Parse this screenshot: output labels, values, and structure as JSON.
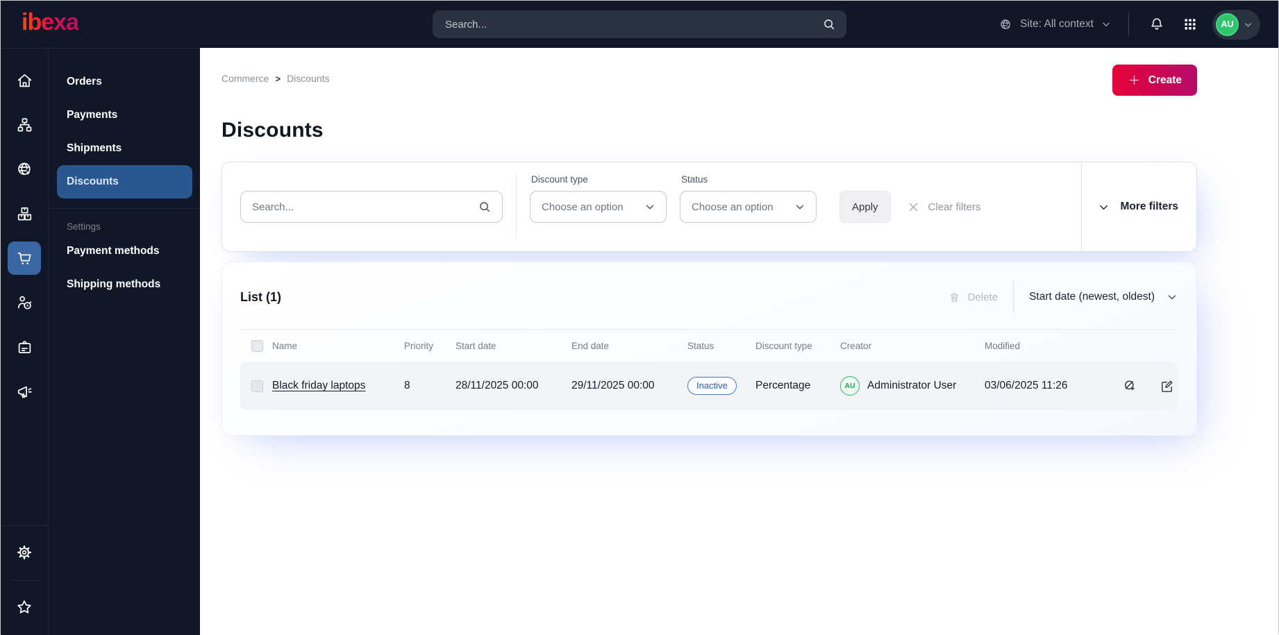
{
  "topbar": {
    "logo_text": "ibexa",
    "search_placeholder": "Search...",
    "site_context_label": "Site: All context",
    "avatar_initials": "AU"
  },
  "menu": {
    "items": [
      {
        "label": "Orders"
      },
      {
        "label": "Payments"
      },
      {
        "label": "Shipments"
      },
      {
        "label": "Discounts"
      }
    ],
    "active_item": "Discounts",
    "settings_heading": "Settings",
    "settings_items": [
      {
        "label": "Payment methods"
      },
      {
        "label": "Shipping methods"
      }
    ]
  },
  "breadcrumb": {
    "item0": "Commerce",
    "separator": ">",
    "item1": "Discounts"
  },
  "page": {
    "title": "Discounts",
    "create_label": "Create"
  },
  "filters": {
    "search_placeholder": "Search...",
    "discount_type_label": "Discount type",
    "discount_type_value": "Choose an option",
    "status_label": "Status",
    "status_value": "Choose an option",
    "apply_label": "Apply",
    "clear_label": "Clear filters",
    "more_label": "More filters"
  },
  "list": {
    "title": "List (1)",
    "delete_label": "Delete",
    "sort_label": "Start date (newest, oldest)",
    "columns": {
      "name": "Name",
      "priority": "Priority",
      "start": "Start date",
      "end": "End date",
      "status": "Status",
      "type": "Discount type",
      "creator": "Creator",
      "modified": "Modified"
    },
    "rows": [
      {
        "name": "Black friday laptops",
        "priority": "8",
        "start": "28/11/2025 00:00",
        "end": "29/11/2025 00:00",
        "status": "Inactive",
        "type": "Percentage",
        "creator_initials": "AU",
        "creator": "Administrator User",
        "modified": "03/06/2025 11:26"
      }
    ]
  },
  "colors": {
    "topbar_bg": "#111726",
    "active_blue": "#2b5790",
    "rail_active_blue": "#3a66a3",
    "brand_gradient_start": "#e30139",
    "brand_gradient_end": "#b50c69",
    "badge_blue": "#2e5fa8",
    "avatar_green": "#2fc56d",
    "row_bg": "#f3f4f7"
  }
}
